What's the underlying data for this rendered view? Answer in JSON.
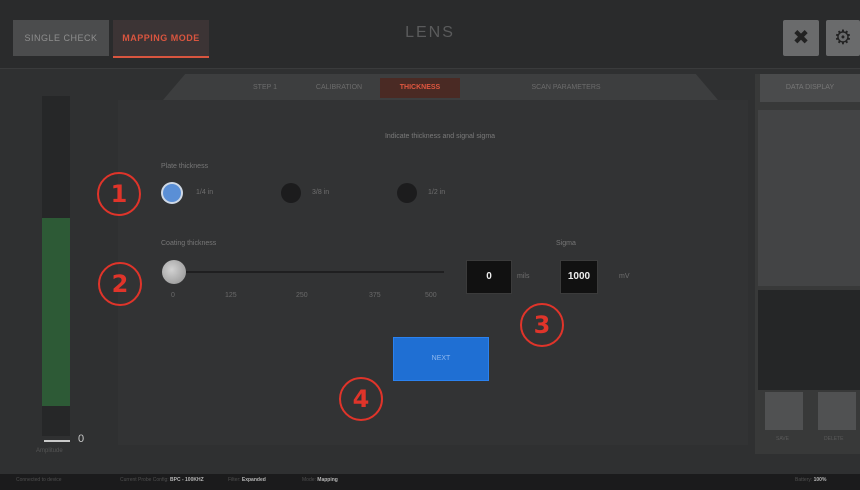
{
  "header": {
    "single_check_label": "SINGLE CHECK",
    "mapping_mode_label": "MAPPING MODE",
    "app_title": "LENS",
    "expand_icon": "expand-icon",
    "settings_icon": "gear-icon"
  },
  "tabs": [
    {
      "label": "STEP 1"
    },
    {
      "label": "CALIBRATION"
    },
    {
      "label": "THICKNESS"
    },
    {
      "label": "SCAN PARAMETERS"
    }
  ],
  "right_panel": {
    "tab_label": "DATA DISPLAY",
    "buttons": [
      {
        "label": "SAVE"
      },
      {
        "label": "DELETE"
      }
    ]
  },
  "level_meter": {
    "value": "0",
    "caption": "Amplitude"
  },
  "thickness": {
    "instruction": "Indicate thickness and signal sigma",
    "plate_label": "Plate thickness",
    "plate_options": [
      {
        "label": "1/4 in",
        "selected": true
      },
      {
        "label": "3/8 in",
        "selected": false
      },
      {
        "label": "1/2 in",
        "selected": false
      }
    ],
    "coating_label": "Coating thickness",
    "slider_ticks": [
      "0",
      "125",
      "250",
      "375",
      "500"
    ],
    "slider_value": 0,
    "coating_value": "0",
    "coating_unit": "mils",
    "sigma_label": "Sigma",
    "sigma_value": "1000",
    "sigma_unit": "mV",
    "apply_label": "NEXT"
  },
  "callouts": [
    "1",
    "2",
    "3",
    "4"
  ],
  "status": {
    "items": [
      {
        "label": "Connected to device",
        "value": ""
      },
      {
        "label": "Current Probe Config:",
        "value": "BPC - 100KHZ"
      },
      {
        "label": "Filter:",
        "value": "Expanded"
      },
      {
        "label": "Mode:",
        "value": "Mapping"
      },
      {
        "label": "Battery:",
        "value": "100%"
      }
    ]
  },
  "colors": {
    "accent": "#e0573f",
    "primary": "#1f6fd3",
    "callout": "#e0342a"
  }
}
